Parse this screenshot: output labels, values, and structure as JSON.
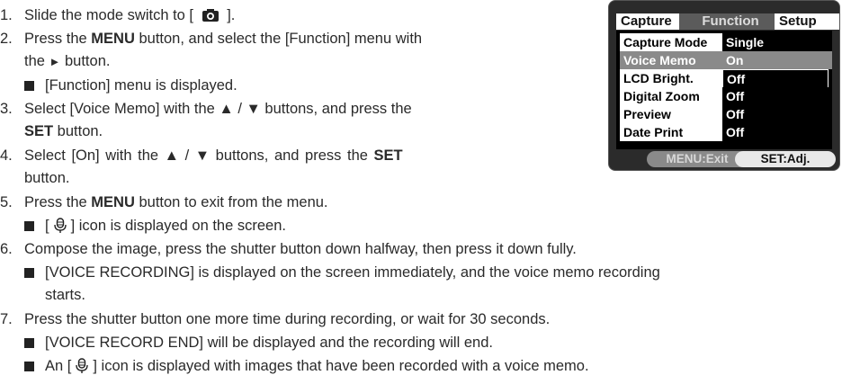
{
  "steps": [
    {
      "num": "1.",
      "before": "Slide the mode switch to [",
      "icon": "camera-icon",
      "after": "]."
    },
    {
      "num": "2.",
      "line1_a": "Press the ",
      "line1_b": "MENU",
      "line1_c": " button, and select the [Function] menu with",
      "line2_a": "the ",
      "line2_arrow": "►",
      "line2_b": " button.",
      "bullet": "[Function] menu is displayed."
    },
    {
      "num": "3.",
      "line1": "Select [Voice Memo] with the ▲ / ▼ buttons, and press the",
      "line2_a": "SET",
      "line2_b": " button."
    },
    {
      "num": "4.",
      "line1_a": "Select [On] with the ▲ / ▼ buttons, and press the ",
      "line1_b": "SET",
      "line2": "button."
    },
    {
      "num": "5.",
      "line1_a": "Press the ",
      "line1_b": "MENU",
      "line1_c": " button to exit from the menu.",
      "bullet_a": "[",
      "bullet_icon": "voice-memo-icon",
      "bullet_b": "] icon is displayed on the screen."
    },
    {
      "num": "6.",
      "line1": "Compose the image, press the shutter button down halfway, then press it down fully.",
      "bullet_line1": "[VOICE RECORDING] is displayed on the screen immediately, and the voice memo recording",
      "bullet_line2": "starts."
    },
    {
      "num": "7.",
      "line1": "Press the shutter button one more time during recording, or wait for 30 seconds.",
      "bullet1": "[VOICE RECORD END] will be displayed and the recording will end.",
      "bullet2_a": "An [",
      "bullet2_icon": "voice-memo-icon",
      "bullet2_b": "] icon is displayed with images that have been recorded with a voice memo."
    }
  ],
  "lcd": {
    "tabs": [
      "Capture",
      "Function",
      "Setup"
    ],
    "active_tab": "Function",
    "rows": [
      {
        "label": "Capture Mode",
        "value": "Single"
      },
      {
        "label": "Voice Memo",
        "value": "On"
      },
      {
        "label": "LCD Bright.",
        "value": "Off"
      },
      {
        "label": "Digital Zoom",
        "value": "Off"
      },
      {
        "label": "Preview",
        "value": "Off"
      },
      {
        "label": "Date Print",
        "value": "Off"
      }
    ],
    "footer_exit": "MENU:Exit",
    "footer_set": "SET:Adj."
  },
  "colors": {
    "panel_bg": "#2b2b2b",
    "highlight_grey": "#8a8a8a",
    "text": "#2a2a2a"
  }
}
